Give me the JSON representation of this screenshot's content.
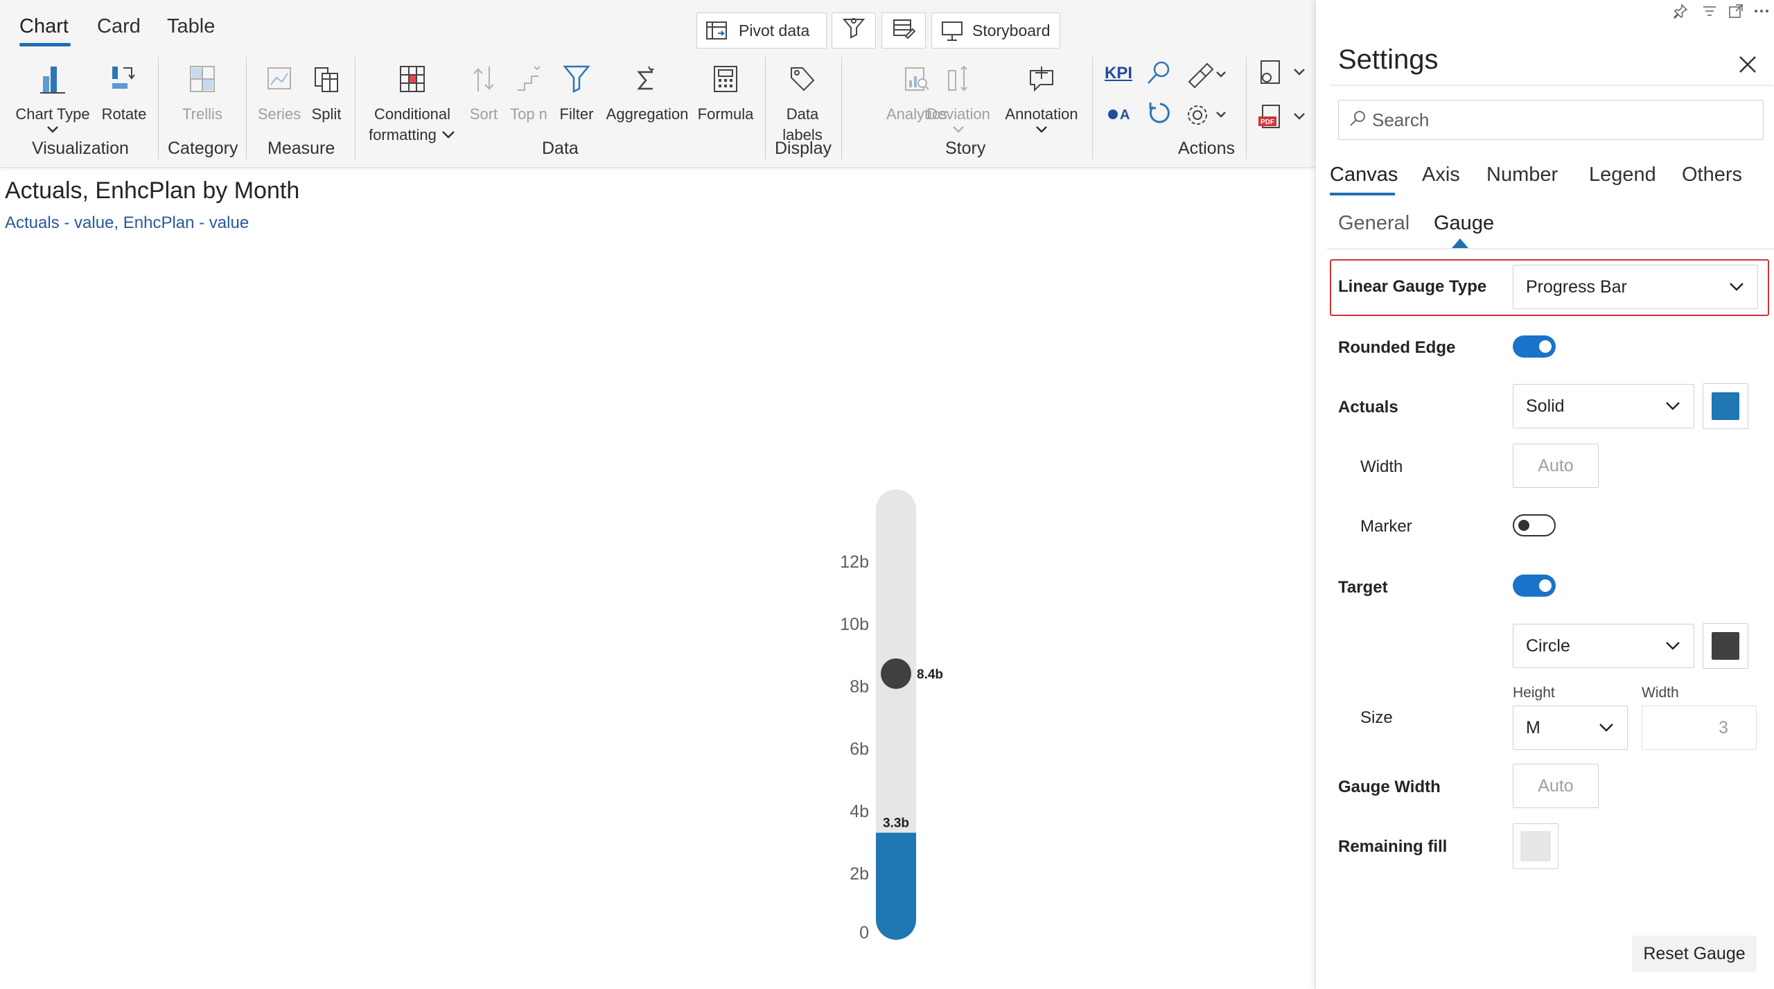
{
  "tabs": [
    "Chart",
    "Card",
    "Table"
  ],
  "top_buttons": {
    "pivot": "Pivot data",
    "storyboard": "Storyboard"
  },
  "ribbon": {
    "chart_type": "Chart Type",
    "rotate": "Rotate",
    "trellis": "Trellis",
    "series": "Series",
    "split": "Split",
    "conditional_1": "Conditional",
    "conditional_2": "formatting",
    "sort": "Sort",
    "topn": "Top n",
    "filter": "Filter",
    "aggregation": "Aggregation",
    "formula": "Formula",
    "data_labels_1": "Data",
    "data_labels_2": "labels",
    "analytics": "Analytics",
    "deviation": "Deviation",
    "annotation": "Annotation",
    "kpi": "KPI",
    "groups": {
      "visualization": "Visualization",
      "category": "Category",
      "measure": "Measure",
      "data": "Data",
      "display": "Display",
      "story": "Story",
      "actions": "Actions"
    }
  },
  "chart": {
    "title": "Actuals, EnhcPlan by Month",
    "subtitle": "Actuals - value, EnhcPlan - value"
  },
  "chart_data": {
    "type": "bar",
    "orientation": "vertical-linear-gauge",
    "categories": [
      "Actuals"
    ],
    "values": [
      3.3
    ],
    "target": 8.4,
    "value_label": "3.3b",
    "target_label": "8.4b",
    "ylim": [
      0,
      14
    ],
    "yticks": [
      {
        "v": 0,
        "label": "0"
      },
      {
        "v": 2,
        "label": "2b"
      },
      {
        "v": 4,
        "label": "4b"
      },
      {
        "v": 6,
        "label": "6b"
      },
      {
        "v": 8,
        "label": "8b"
      },
      {
        "v": 10,
        "label": "10b"
      },
      {
        "v": 12,
        "label": "12b"
      }
    ],
    "colors": {
      "fill": "#1f77b4",
      "remaining": "#e6e6e6",
      "target": "#404040"
    }
  },
  "panel": {
    "title": "Settings",
    "search_placeholder": "Search",
    "tabs": [
      "Canvas",
      "Axis",
      "Number",
      "Legend",
      "Others"
    ],
    "subtabs": [
      "General",
      "Gauge"
    ],
    "linear_gauge_type_label": "Linear Gauge Type",
    "linear_gauge_type_value": "Progress Bar",
    "rounded_edge_label": "Rounded Edge",
    "actuals_label": "Actuals",
    "actuals_style": "Solid",
    "actuals_color": "#1f77b4",
    "width_label": "Width",
    "width_placeholder": "Auto",
    "marker_label": "Marker",
    "target_label": "Target",
    "target_shape": "Circle",
    "target_color": "#404040",
    "size_label": "Size",
    "height_label": "Height",
    "width_col_label": "Width",
    "size_height_value": "M",
    "size_width_value": "3",
    "gauge_width_label": "Gauge Width",
    "gauge_width_placeholder": "Auto",
    "remaining_fill_label": "Remaining fill",
    "remaining_fill_color": "#e6e6e6",
    "reset_label": "Reset Gauge"
  },
  "colors": {
    "accent": "#1f6fb2",
    "highlight_border": "#d13438"
  }
}
